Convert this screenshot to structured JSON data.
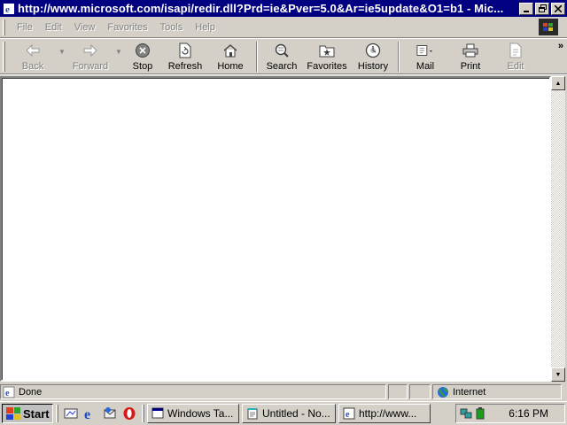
{
  "window": {
    "title": "http://www.microsoft.com/isapi/redir.dll?Prd=ie&Pver=5.0&Ar=ie5update&O1=b1 - Mic...",
    "controls": [
      "minimize",
      "maximize",
      "close"
    ]
  },
  "menu": {
    "items": [
      "File",
      "Edit",
      "View",
      "Favorites",
      "Tools",
      "Help"
    ]
  },
  "toolbar": {
    "back": "Back",
    "forward": "Forward",
    "stop": "Stop",
    "refresh": "Refresh",
    "home": "Home",
    "search": "Search",
    "favorites": "Favorites",
    "history": "History",
    "mail": "Mail",
    "print": "Print",
    "edit": "Edit",
    "more": "»"
  },
  "status": {
    "text": "Done",
    "zone": "Internet"
  },
  "taskbar": {
    "start": "Start",
    "buttons": [
      "Windows Ta...",
      "Untitled - No...",
      "http://www..."
    ],
    "clock": "6:16 PM"
  },
  "colors": {
    "titlebar": "#000080",
    "chrome": "#d4d0c8"
  }
}
